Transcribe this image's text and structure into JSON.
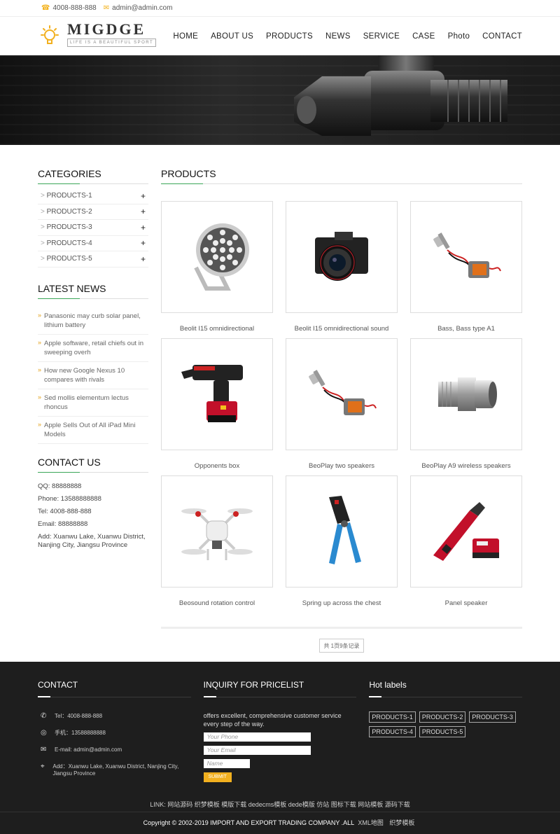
{
  "topbar": {
    "phone": "4008-888-888",
    "email": "admin@admin.com"
  },
  "logo": {
    "name": "MIGDGE",
    "tagline": "LIFE IS A BEAUTIFUL SPORT"
  },
  "nav": [
    "HOME",
    "ABOUT US",
    "PRODUCTS",
    "NEWS",
    "SERVICE",
    "CASE",
    "Photo",
    "CONTACT"
  ],
  "sidebar": {
    "categories_title": "CATEGORIES",
    "categories": [
      "PRODUCTS-1",
      "PRODUCTS-2",
      "PRODUCTS-3",
      "PRODUCTS-4",
      "PRODUCTS-5"
    ],
    "news_title": "LATEST NEWS",
    "news": [
      "Panasonic may curb solar panel, lithium battery",
      "Apple software, retail chiefs out in sweeping overh",
      "How new Google Nexus 10 compares with rivals",
      "Sed mollis elementum lectus rhoncus",
      "Apple Sells Out of All iPad Mini Models"
    ],
    "contact_title": "CONTACT US",
    "contact": {
      "qq": "QQ: 88888888",
      "phone": "Phone: 13588888888",
      "tel": "Tel: 4008-888-888",
      "email": "Email: 88888888",
      "add": "Add: Xuanwu Lake, Xuanwu District, Nanjing City, Jiangsu Province"
    }
  },
  "products": {
    "title": "PRODUCTS",
    "items": [
      {
        "caption": "Beolit I15 omnidirectional",
        "icon": "floodlight-icon"
      },
      {
        "caption": "Beolit I15 omnidirectional sound",
        "icon": "camera-icon"
      },
      {
        "caption": "Bass, Bass type A1",
        "icon": "spotlight-icon"
      },
      {
        "caption": "Opponents box",
        "icon": "power-tool-icon"
      },
      {
        "caption": "BeoPlay two speakers",
        "icon": "spotlight-icon"
      },
      {
        "caption": "BeoPlay A9 wireless speakers",
        "icon": "pipe-fitting-icon"
      },
      {
        "caption": "Beosound rotation control",
        "icon": "drone-icon"
      },
      {
        "caption": "Spring up across the chest",
        "icon": "crimper-icon"
      },
      {
        "caption": "Panel speaker",
        "icon": "hammer-drill-icon"
      }
    ],
    "pager": "共 1页9条记录"
  },
  "footer": {
    "contact_title": "CONTACT",
    "tel": "Tel：4008-888-888",
    "mobile": "手机：13588888888",
    "email": "E-mail: admin@admin.com",
    "add": "Add：Xuanwu Lake, Xuanwu District, Nanjing City, Jiangsu Province",
    "inquiry_title": "INQUIRY FOR PRICELIST",
    "inquiry_text": "offers excellent, comprehensive customer service every step of the way.",
    "phone_placeholder": "Your Phone",
    "email_placeholder": "Your Email",
    "name_placeholder": "Name",
    "submit": "SUBMIT",
    "labels_title": "Hot labels",
    "labels": [
      "PRODUCTS-1",
      "PRODUCTS-2",
      "PRODUCTS-3",
      "PRODUCTS-4",
      "PRODUCTS-5"
    ],
    "links": "LINK: 网站源码 织梦模板 模版下载 dedecms模板 dede模版 仿站 图标下载 网站模板 源码下载",
    "copyright": "Copyright © 2002-2019 IMPORT AND EXPORT TRADING COMPANY .ALL",
    "sitemap": "XML地图",
    "theme": "织梦模板"
  },
  "colors": {
    "accent": "#f2b01f",
    "green": "#3aa657",
    "footer_bg": "#1e1e1e"
  }
}
